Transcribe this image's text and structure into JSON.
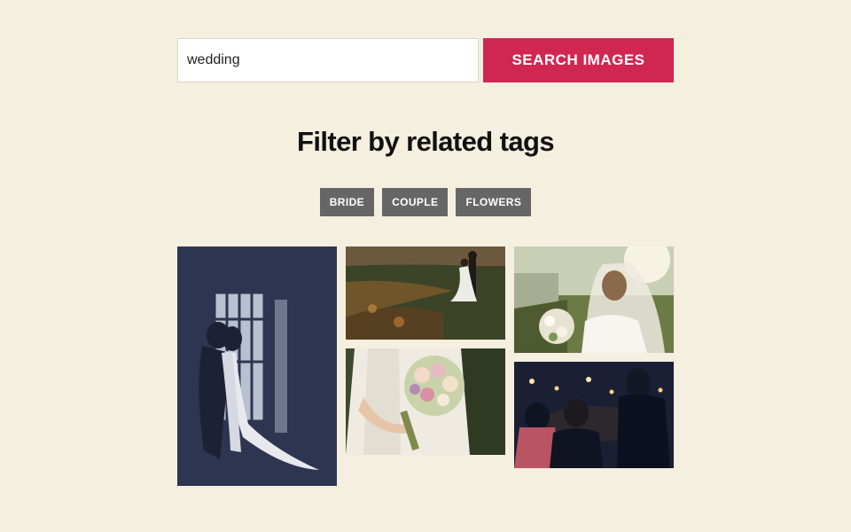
{
  "search": {
    "value": "wedding",
    "button_label": "SEARCH IMAGES"
  },
  "filter": {
    "heading": "Filter by related tags",
    "tags": [
      "BRIDE",
      "COUPLE",
      "FLOWERS"
    ]
  },
  "colors": {
    "page_background": "#f5efe0",
    "search_button": "#d02752",
    "tag_background": "#666666"
  },
  "gallery": {
    "images": [
      {
        "subject": "couple-silhouette-window"
      },
      {
        "subject": "couple-in-vineyard"
      },
      {
        "subject": "bride-with-veil-and-bouquet"
      },
      {
        "subject": "bride-holding-bouquet"
      },
      {
        "subject": "guests-with-sparklers"
      }
    ]
  }
}
